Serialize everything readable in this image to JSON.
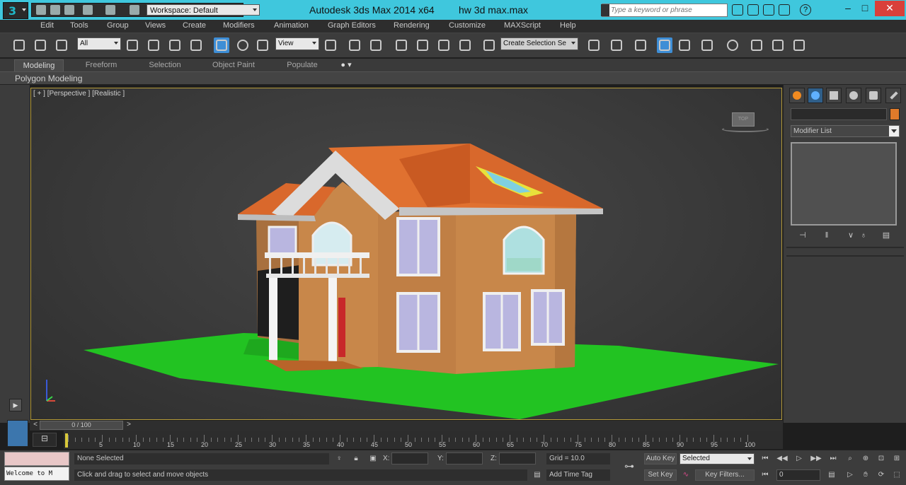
{
  "window": {
    "app_title": "Autodesk 3ds Max  2014 x64",
    "document": "hw 3d max.max",
    "workspace": "Workspace: Default",
    "search_placeholder": "Type a keyword or phrase",
    "minimize": "–",
    "maximize": "□",
    "close": "✕",
    "help": "?"
  },
  "menu": [
    "Edit",
    "Tools",
    "Group",
    "Views",
    "Create",
    "Modifiers",
    "Animation",
    "Graph Editors",
    "Rendering",
    "Customize",
    "MAXScript",
    "Help"
  ],
  "toolbar": {
    "selection_filter": "All",
    "ref_coord": "View",
    "named_selection": "Create Selection Se"
  },
  "ribbon": {
    "tabs": [
      "Modeling",
      "Freeform",
      "Selection",
      "Object Paint",
      "Populate"
    ],
    "active_tab": "Modeling",
    "panel_label": "Polygon Modeling"
  },
  "viewport": {
    "label": "[ + ] [Perspective ] [Realistic ]",
    "viewcube_label": "TOP"
  },
  "command_panel": {
    "modifier_list": "Modifier List",
    "object_color": "#e07a2a"
  },
  "timeline": {
    "slider_text": "0 / 100",
    "prev": "<",
    "next": ">",
    "ticks": [
      "5",
      "10",
      "15",
      "20",
      "25",
      "30",
      "35",
      "40",
      "45",
      "50",
      "55",
      "60",
      "65",
      "70",
      "75",
      "80",
      "85",
      "90",
      "95",
      "100"
    ]
  },
  "status": {
    "maxscript_listener": "Welcome to M",
    "selection": "None Selected",
    "prompt": "Click and drag to select and move objects",
    "x_label": "X:",
    "y_label": "Y:",
    "z_label": "Z:",
    "grid": "Grid = 10.0",
    "add_time_tag": "Add Time Tag",
    "auto_key": "Auto Key",
    "set_key": "Set Key",
    "key_mode": "Selected",
    "key_filters": "Key Filters...",
    "current_frame": "0"
  },
  "scene_colors": {
    "ground": "#22c322",
    "walls": "#c8874a",
    "roof": "#d9682c",
    "trim": "#dcdcdc",
    "window": "#b9b6e0"
  }
}
